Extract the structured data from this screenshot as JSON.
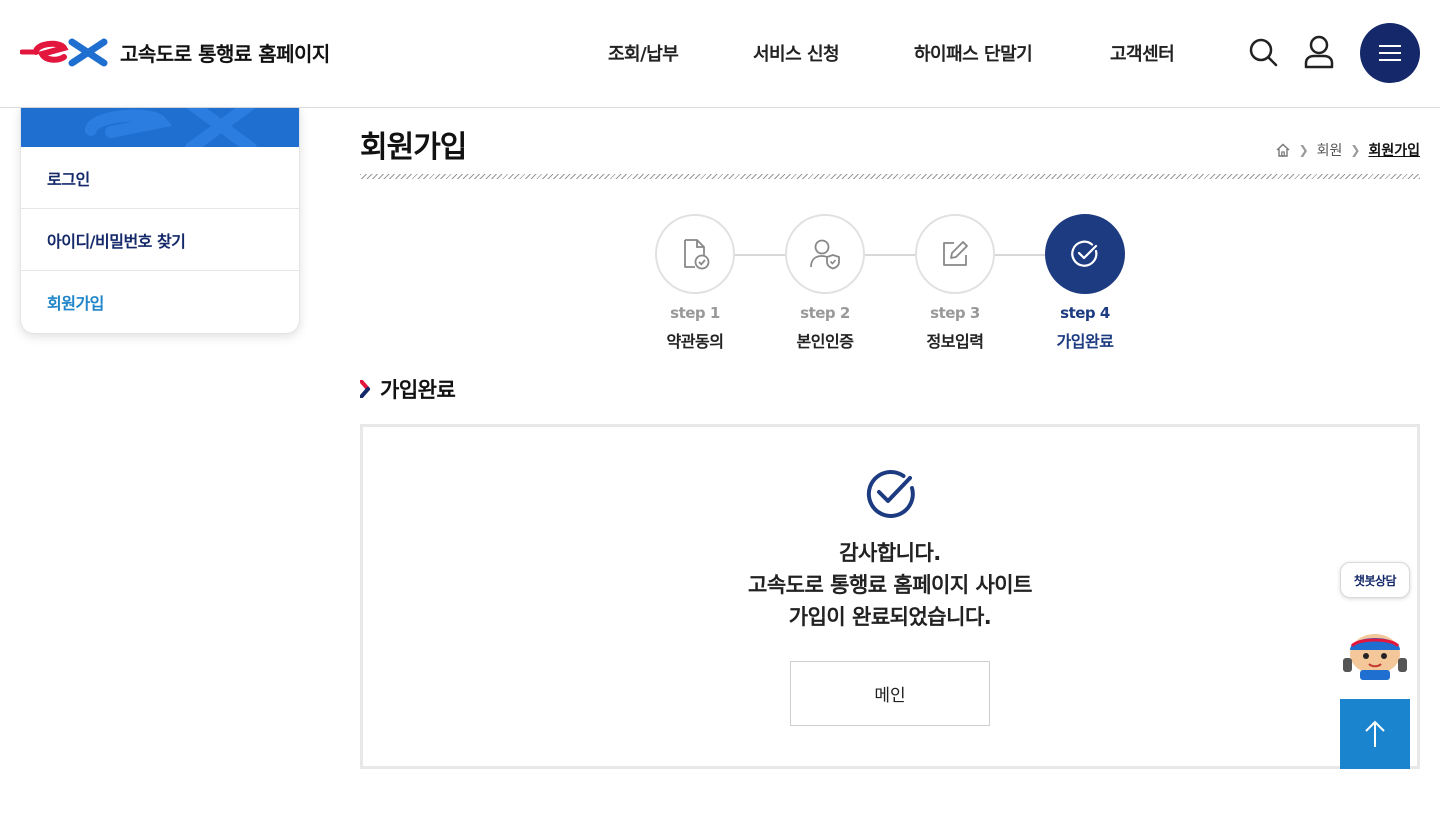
{
  "header": {
    "site_title": "고속도로 통행료 홈페이지",
    "nav": [
      "조회/납부",
      "서비스 신청",
      "하이패스 단말기",
      "고객센터"
    ],
    "icons": [
      "search-icon",
      "user-icon",
      "menu-icon"
    ]
  },
  "sidebar": {
    "items": [
      {
        "label": "로그인",
        "active": false
      },
      {
        "label": "아이디/비밀번호 찾기",
        "active": false
      },
      {
        "label": "회원가입",
        "active": true
      }
    ]
  },
  "page": {
    "title": "회원가입",
    "breadcrumb": [
      "회원",
      "회원가입"
    ]
  },
  "steps": [
    {
      "num": "step 1",
      "label": "약관동의",
      "icon": "document-check-icon",
      "active": false
    },
    {
      "num": "step 2",
      "label": "본인인증",
      "icon": "user-shield-icon",
      "active": false
    },
    {
      "num": "step 3",
      "label": "정보입력",
      "icon": "edit-icon",
      "active": false
    },
    {
      "num": "step 4",
      "label": "가입완료",
      "icon": "check-circle-icon",
      "active": true
    }
  ],
  "section": {
    "heading": "가입완료"
  },
  "result": {
    "line1": "감사합니다.",
    "line2": "고속도로 통행료 홈페이지 사이트",
    "line3": "가입이 완료되었습니다.",
    "button_label": "메인"
  },
  "floating": {
    "chatbot_label": "챗봇상담"
  },
  "colors": {
    "brand_navy": "#15296a",
    "step_active": "#1d3b80",
    "accent_blue": "#1a84cf",
    "brand_red": "#e3173e"
  }
}
